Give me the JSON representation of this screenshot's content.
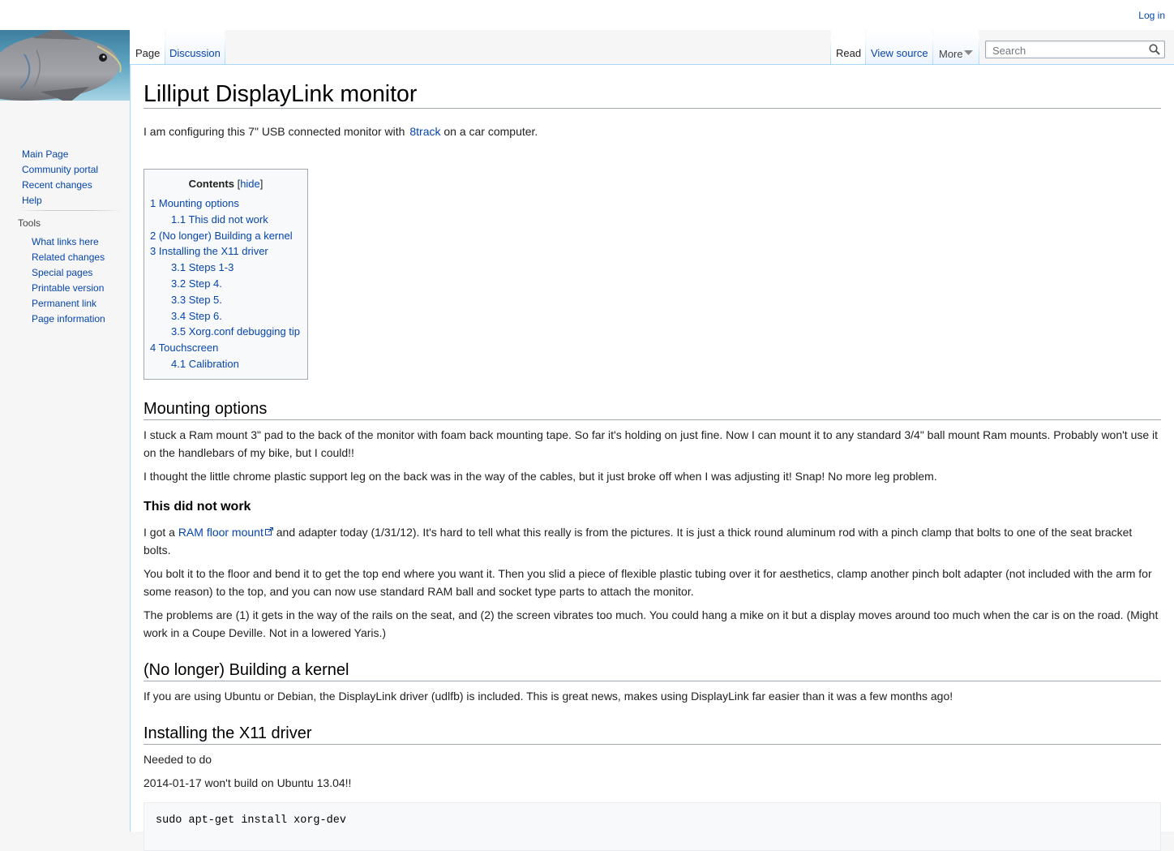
{
  "personal": {
    "login": "Log in"
  },
  "tabs": {
    "page": "Page",
    "discussion": "Discussion",
    "read": "Read",
    "view_source": "View source",
    "more": "More"
  },
  "search": {
    "placeholder": "Search"
  },
  "sidebar": {
    "main": [
      "Main Page",
      "Community portal",
      "Recent changes",
      "Help"
    ],
    "tools_heading": "Tools",
    "tools": [
      "What links here",
      "Related changes",
      "Special pages",
      "Printable version",
      "Permanent link",
      "Page information"
    ]
  },
  "article": {
    "title": "Lilliput DisplayLink monitor",
    "intro_pre": "I am configuring this 7\" USB connected monitor with ",
    "intro_link": "8track",
    "intro_post": " on a car computer.",
    "toc": {
      "title": "Contents",
      "hide_open": "[",
      "hide": "hide",
      "hide_close": "]",
      "items": [
        {
          "num": "1",
          "text": "Mounting options",
          "level": 1
        },
        {
          "num": "1.1",
          "text": "This did not work",
          "level": 2
        },
        {
          "num": "2",
          "text": "(No longer) Building a kernel",
          "level": 1
        },
        {
          "num": "3",
          "text": "Installing the X11 driver",
          "level": 1
        },
        {
          "num": "3.1",
          "text": "Steps 1-3",
          "level": 2
        },
        {
          "num": "3.2",
          "text": "Step 4.",
          "level": 2
        },
        {
          "num": "3.3",
          "text": "Step 5.",
          "level": 2
        },
        {
          "num": "3.4",
          "text": "Step 6.",
          "level": 2
        },
        {
          "num": "3.5",
          "text": "Xorg.conf debugging tip",
          "level": 2
        },
        {
          "num": "4",
          "text": "Touchscreen",
          "level": 1
        },
        {
          "num": "4.1",
          "text": "Calibration",
          "level": 2
        }
      ]
    },
    "mounting": {
      "heading": "Mounting options",
      "p1": "I stuck a Ram mount 3\" pad to the back of the monitor with foam back mounting tape. So far it's holding on just fine. Now I can mount it to any standard 3/4\" ball mount Ram mounts. Probably won't use it on the handlebars of my bike, but I could!!",
      "p2": "I thought the little chrome plastic support leg on the back was in the way of the cables, but it just broke off when I was adjusting it! Snap! No more leg problem."
    },
    "did_not_work": {
      "heading": "This did not work",
      "p1_pre": "I got a ",
      "p1_link": "RAM floor mount",
      "p1_post": " and adapter today (1/31/12). It's hard to tell what this really is from the pictures. It is just a thick round aluminum rod with a pinch clamp that bolts to one of the seat bracket bolts.",
      "p2": "You bolt it to the floor and bend it to get the top end where you want it. Then you slid a piece of flexible plastic tubing over it for aesthetics, clamp another pinch bolt adapter (not included with the arm for some reason) to the top, and you can now use standard RAM ball and socket type parts to attach the monitor.",
      "p3": "The problems are (1) it gets in the way of the rails on the seat, and (2) the screen vibrates too much. You could hang a mike on it but a display moves around too much when the car is on the road. (Might work in a Coupe Deville. Not in a lowered Yaris.)"
    },
    "kernel": {
      "heading": "(No longer) Building a kernel",
      "p1": "If you are using Ubuntu or Debian, the DisplayLink driver (udlfb) is included. This is great news, makes using DisplayLink far easier than it was a few months ago!"
    },
    "x11": {
      "heading": "Installing the X11 driver",
      "p1": "Needed to do",
      "p2": "2014-01-17 won't build on Ubuntu 13.04!!",
      "code": "sudo apt-get install xorg-dev"
    }
  }
}
